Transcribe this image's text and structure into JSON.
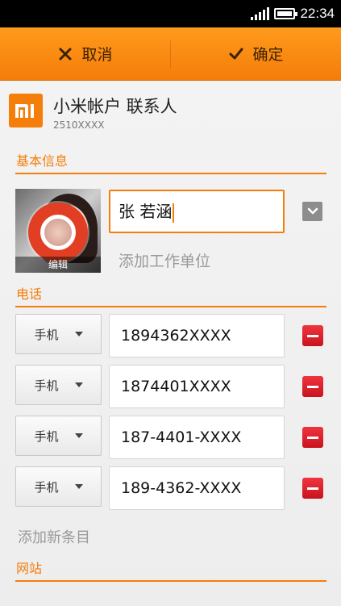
{
  "status_bar": {
    "time": "22:34",
    "signal_icon": "signal-icon",
    "battery_icon": "battery-icon"
  },
  "action_bar": {
    "cancel_label": "取消",
    "confirm_label": "确定",
    "accent_color": "#f57d0a"
  },
  "account": {
    "title": "小米帐户 联系人",
    "subtitle": "2510XXXX",
    "logo_icon": "mi-logo-icon"
  },
  "basic_info": {
    "header": "基本信息",
    "photo_edit_label": "编辑",
    "name_value": "张 若涵",
    "add_company_label": "添加工作单位"
  },
  "phone": {
    "header": "电话",
    "entries": [
      {
        "type": "手机",
        "number": "1894362XXXX"
      },
      {
        "type": "手机",
        "number": "1874401XXXX"
      },
      {
        "type": "手机",
        "number": "187-4401-XXXX"
      },
      {
        "type": "手机",
        "number": "189-4362-XXXX"
      }
    ],
    "add_entry_label": "添加新条目"
  },
  "website": {
    "header": "网站"
  }
}
